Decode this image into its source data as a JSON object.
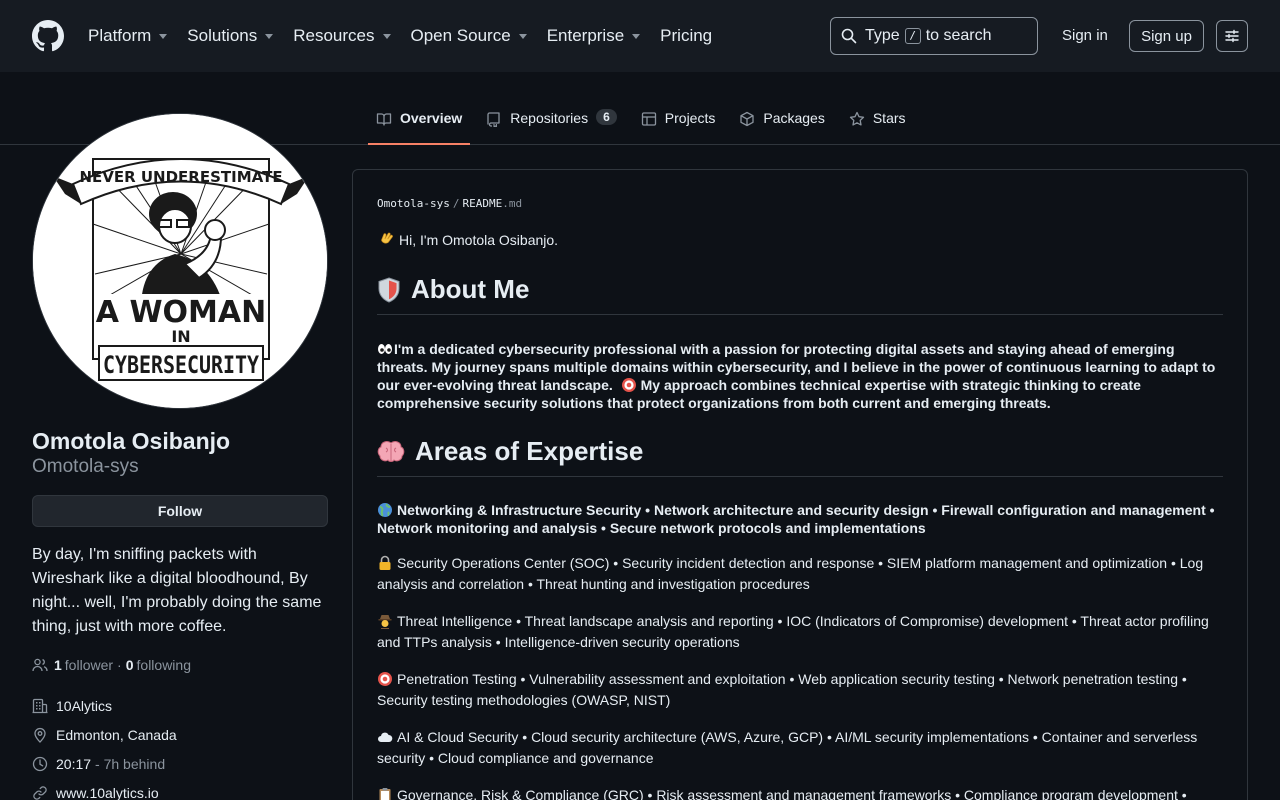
{
  "header": {
    "nav": [
      "Platform",
      "Solutions",
      "Resources",
      "Open Source",
      "Enterprise",
      "Pricing"
    ],
    "nav_has_caret": [
      true,
      true,
      true,
      true,
      true,
      false
    ],
    "search_prefix": "Type",
    "search_key": "/",
    "search_suffix": "to search",
    "signin": "Sign in",
    "signup": "Sign up"
  },
  "tabs": {
    "overview": "Overview",
    "repositories": "Repositories",
    "repositories_count": "6",
    "projects": "Projects",
    "packages": "Packages",
    "stars": "Stars"
  },
  "profile": {
    "avatar_text_top": "NEVER UNDERESTIMATE",
    "avatar_text_mid1": "A WOMAN",
    "avatar_text_mid2": "IN",
    "avatar_text_bottom": "CYBERSECURITY",
    "name": "Omotola Osibanjo",
    "login": "Omotola-sys",
    "follow": "Follow",
    "bio": "By day, I'm sniffing packets with Wireshark like a digital bloodhound, By night... well, I'm probably doing the same thing, just with more coffee.",
    "followers_count": "1",
    "followers_label": "follower",
    "dot": "·",
    "following_count": "0",
    "following_label": "following",
    "company": "10Alytics",
    "location": "Edmonton, Canada",
    "time": "20:17",
    "time_behind": "- 7h behind",
    "website": "www.10alytics.io"
  },
  "readme": {
    "owner": "Omotola-sys",
    "slash": "/",
    "file": "README",
    "ext": ".md",
    "greeting": "Hi, I'm Omotola Osibanjo.",
    "about_title": "About Me",
    "about_text": "I'm a dedicated cybersecurity professional with a passion for protecting digital assets and staying ahead of emerging threats. My journey spans multiple domains within cybersecurity, and I believe in the power of continuous learning to adapt to our ever-evolving threat landscape.",
    "about_text2": "My approach combines technical expertise with strategic thinking to create comprehensive security solutions that protect organizations from both current and emerging threats.",
    "expertise_title": "Areas of Expertise",
    "expertise": [
      "Networking & Infrastructure Security • Network architecture and security design • Firewall configuration and management • Network monitoring and analysis • Secure network protocols and implementations",
      "Security Operations Center (SOC) • Security incident detection and response • SIEM platform management and optimization • Log analysis and correlation • Threat hunting and investigation procedures",
      "Threat Intelligence • Threat landscape analysis and reporting • IOC (Indicators of Compromise) development • Threat actor profiling and TTPs analysis • Intelligence-driven security operations",
      "Penetration Testing • Vulnerability assessment and exploitation • Web application security testing • Network penetration testing • Security testing methodologies (OWASP, NIST)",
      "AI & Cloud Security • Cloud security architecture (AWS, Azure, GCP) • AI/ML security implementations • Container and serverless security • Cloud compliance and governance",
      "Governance, Risk & Compliance (GRC) • Risk assessment and management frameworks • Compliance program development •"
    ]
  }
}
